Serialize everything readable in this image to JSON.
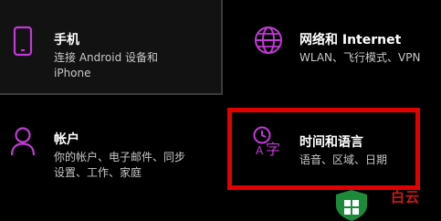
{
  "colors": {
    "accent": "#c239d6",
    "highlight_box": "#e00000",
    "background": "#000000",
    "tile_bg": "#121212",
    "desc_text": "#c8c8c8",
    "watermark_green": "#1d8a3a",
    "watermark_red": "#d11818"
  },
  "tiles": {
    "phone": {
      "title": "手机",
      "desc_line1": "连接 Android 设备和",
      "desc_line2": "iPhone",
      "icon": "phone-icon"
    },
    "network": {
      "title": "网络和 Internet",
      "desc": "WLAN、飞行模式、VPN",
      "icon": "globe-icon"
    },
    "account": {
      "title": "帐户",
      "desc_line1": "你的帐户、电子邮件、同步",
      "desc_line2": "设置、工作、家庭",
      "icon": "person-icon"
    },
    "time_language": {
      "title": "时间和语言",
      "desc": "语音、区域、日期",
      "icon": "time-language-icon"
    }
  },
  "watermark": {
    "text": "白云",
    "icon": "windows-shield-icon"
  }
}
